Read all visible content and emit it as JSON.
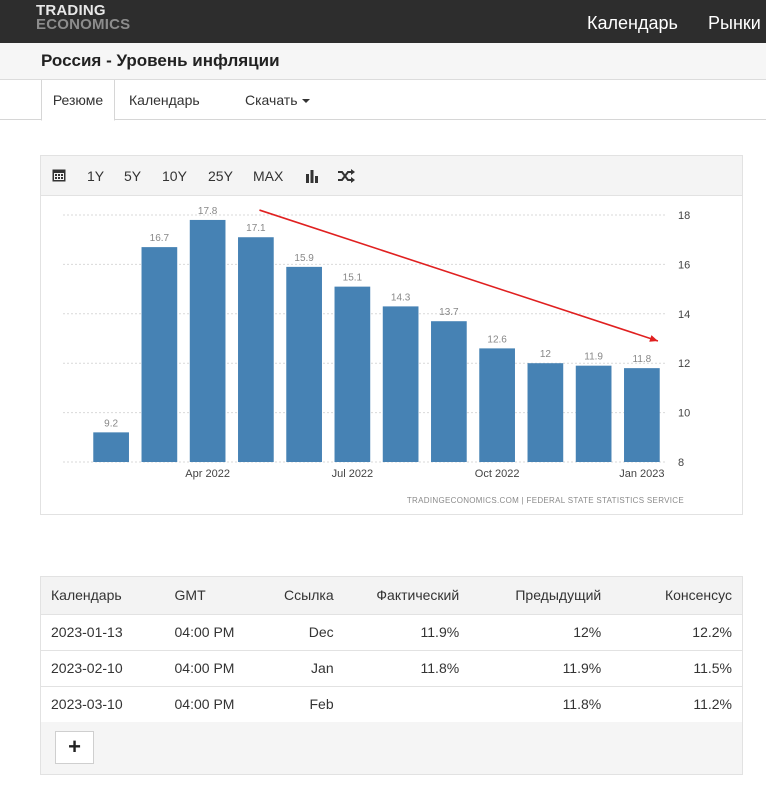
{
  "header": {
    "logo_line1": "TRADING",
    "logo_line2": "ECONOMICS",
    "nav": [
      "Календарь",
      "Рынки"
    ]
  },
  "page": {
    "title": "Россия - Уровень инфляции"
  },
  "tabs": [
    {
      "label": "Резюме",
      "active": true
    },
    {
      "label": "Календарь",
      "active": false
    },
    {
      "label": "Скачать",
      "active": false,
      "dropdown": true
    }
  ],
  "chart_toolbar": {
    "icons": [
      "calendar-icon",
      "bar-chart-icon",
      "shuffle-icon"
    ],
    "ranges": [
      "1Y",
      "5Y",
      "10Y",
      "25Y",
      "MAX"
    ]
  },
  "chart_data": {
    "type": "bar",
    "x": [
      "2022-01",
      "2022-02",
      "2022-03",
      "2022-04",
      "2022-05",
      "2022-06",
      "2022-07",
      "2022-08",
      "2022-09",
      "2022-10",
      "2022-11",
      "2022-12"
    ],
    "values": [
      9.2,
      16.7,
      17.8,
      17.1,
      15.9,
      15.1,
      14.3,
      13.7,
      12.6,
      12,
      11.9,
      11.8
    ],
    "value_labels": [
      "9.2",
      "16.7",
      "17.8",
      "17.1",
      "15.9",
      "15.1",
      "14.3",
      "13.7",
      "12.6",
      "12",
      "11.9",
      "11.8"
    ],
    "x_tick_labels": [
      {
        "label": "Apr 2022",
        "at": "2022-03"
      },
      {
        "label": "Jul 2022",
        "at": "2022-06"
      },
      {
        "label": "Oct 2022",
        "at": "2022-09"
      },
      {
        "label": "Jan 2023",
        "at": "2022-12"
      }
    ],
    "y_ticks": [
      8,
      10,
      12,
      14,
      16,
      18
    ],
    "ylim": [
      8,
      18
    ],
    "y_axis_side": "right",
    "grid": true,
    "bar_color": "#4682b4",
    "trend_arrow": {
      "from": {
        "at": "2022-04",
        "value": 18.2
      },
      "to": {
        "at": "2022-12",
        "value": 12.9
      },
      "color": "#e02020"
    },
    "source": "TRADINGECONOMICS.COM  |  FEDERAL STATE STATISTICS SERVICE"
  },
  "calendar_table": {
    "headers": [
      "Календарь",
      "GMT",
      "Ссылка",
      "Фактический",
      "Предыдущий",
      "Консенсус"
    ],
    "rows": [
      [
        "2023-01-13",
        "04:00 PM",
        "Dec",
        "11.9%",
        "12%",
        "12.2%"
      ],
      [
        "2023-02-10",
        "04:00 PM",
        "Jan",
        "11.8%",
        "11.9%",
        "11.5%"
      ],
      [
        "2023-03-10",
        "04:00 PM",
        "Feb",
        "",
        "11.8%",
        "11.2%"
      ]
    ],
    "more_label": "+"
  }
}
